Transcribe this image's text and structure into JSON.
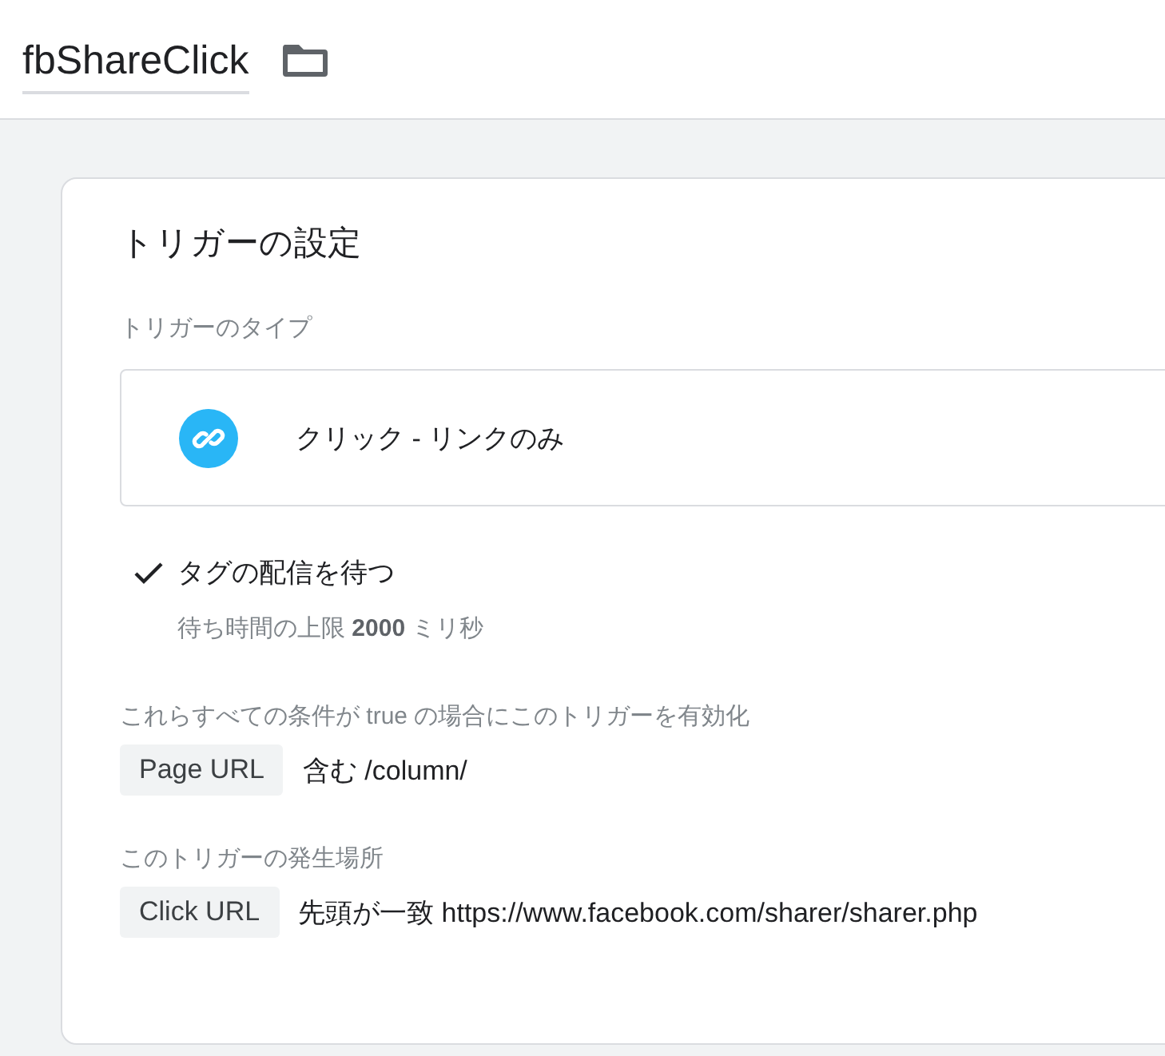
{
  "header": {
    "name": "fbShareClick"
  },
  "card": {
    "title": "トリガーの設定",
    "type_label": "トリガーのタイプ",
    "trigger_type": "クリック - リンクのみ",
    "wait_for_tags": {
      "label": "タグの配信を待つ",
      "checked": true,
      "detail": "待ち時間の上限 **2000** ミリ秒"
    },
    "sections": [
      {
        "label": "これらすべての条件が true の場合にこのトリガーを有効化",
        "filters": [
          {
            "variable": "Page URL",
            "condition": "含む /column/"
          }
        ]
      },
      {
        "label": "このトリガーの発生場所",
        "filters": [
          {
            "variable": "Click URL",
            "condition": "先頭が一致 https://www.facebook.com/sharer/sharer.php"
          }
        ]
      }
    ]
  }
}
